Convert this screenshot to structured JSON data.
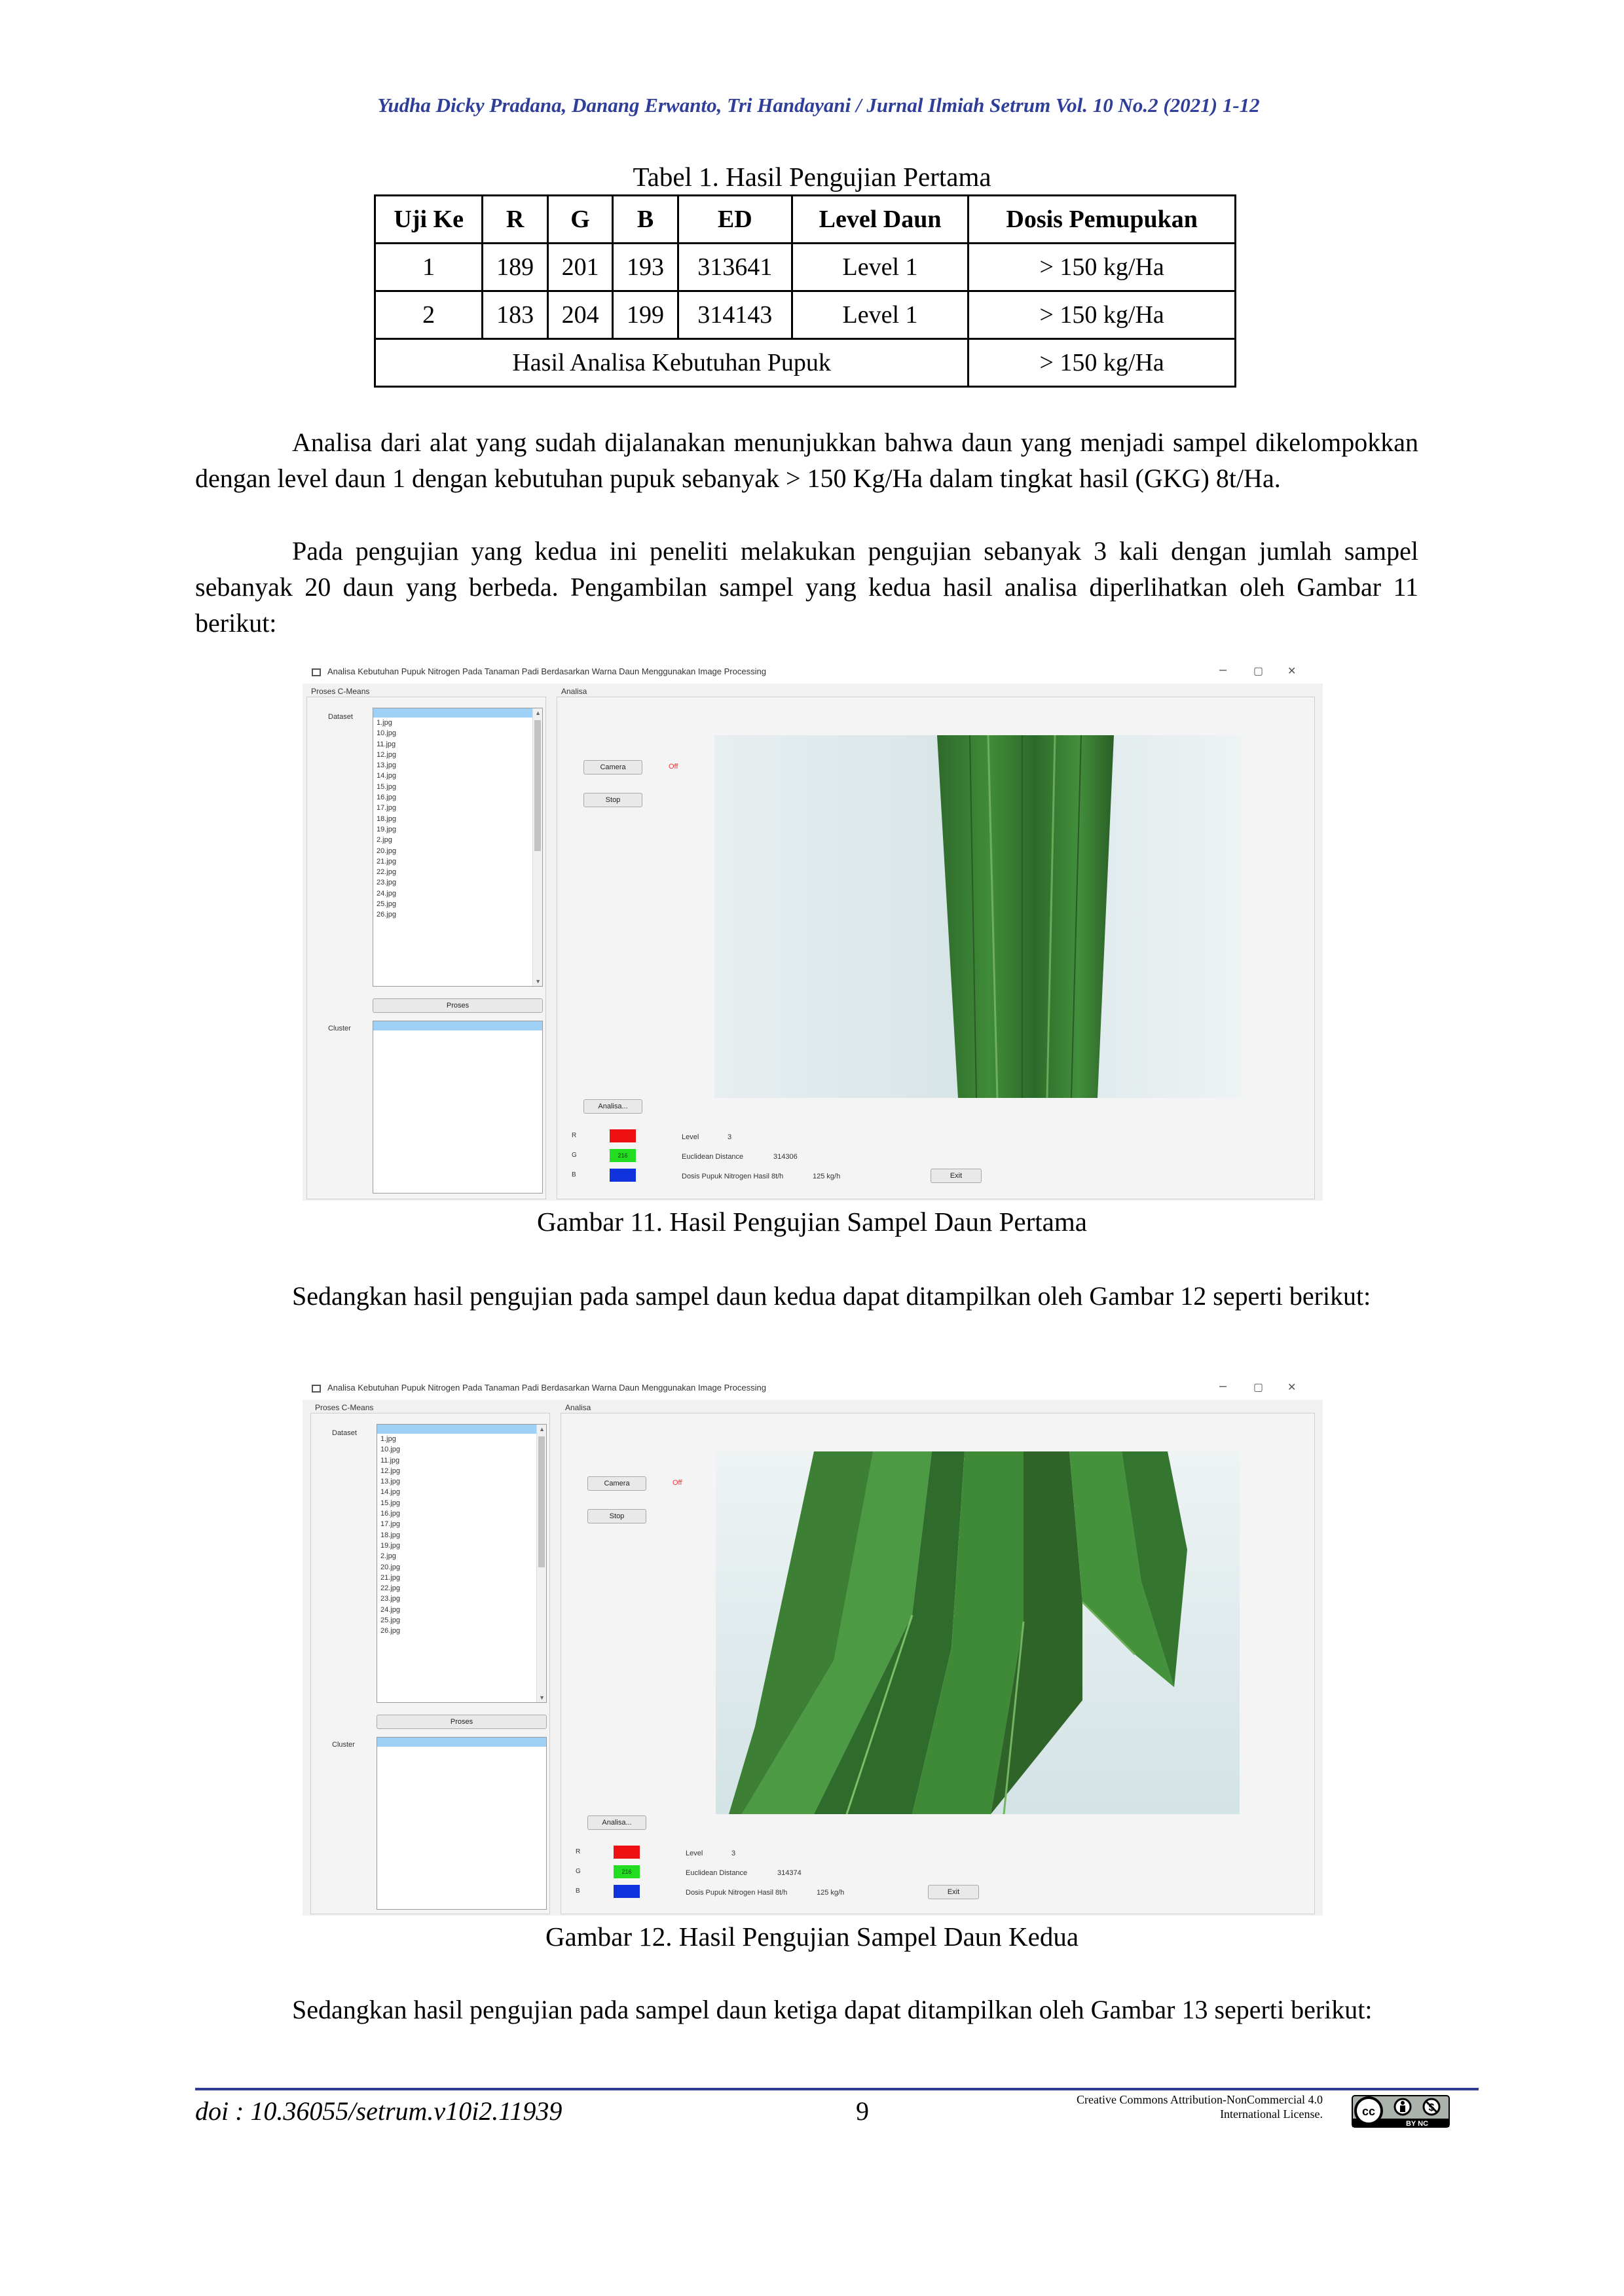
{
  "header": "Yudha Dicky Pradana, Danang Erwanto, Tri Handayani / Jurnal Ilmiah Setrum Vol. 10 No.2 (2021) 1-12",
  "table": {
    "caption": "Tabel 1. Hasil Pengujian Pertama",
    "headers": [
      "Uji Ke",
      "R",
      "G",
      "B",
      "ED",
      "Level Daun",
      "Dosis Pemupukan"
    ],
    "rows": [
      [
        "1",
        "189",
        "201",
        "193",
        "313641",
        "Level 1",
        "> 150 kg/Ha"
      ],
      [
        "2",
        "183",
        "204",
        "199",
        "314143",
        "Level 1",
        "> 150 kg/Ha"
      ]
    ],
    "summary_label": "Hasil Analisa Kebutuhan Pupuk",
    "summary_value": "> 150 kg/Ha"
  },
  "paragraphs": {
    "p1": "Analisa dari alat yang sudah dijalanakan menunjukkan bahwa daun yang menjadi sampel dikelompokkan dengan level daun 1 dengan kebutuhan pupuk sebanyak > 150 Kg/Ha dalam tingkat hasil (GKG) 8t/Ha.",
    "p2": "Pada pengujian yang kedua ini peneliti melakukan pengujian sebanyak 3 kali dengan jumlah sampel sebanyak 20 daun yang berbeda. Pengambilan sampel yang kedua hasil analisa diperlihatkan oleh Gambar 11 berikut:",
    "p3": "Sedangkan hasil pengujian pada sampel daun kedua dapat ditampilkan oleh Gambar 12 seperti berikut:",
    "p4": "Sedangkan hasil pengujian pada sampel daun ketiga dapat ditampilkan oleh Gambar 13 seperti berikut:"
  },
  "app": {
    "title": "Analisa Kebutuhan Pupuk Nitrogen Pada Tanaman Padi Berdasarkan Warna Daun Menggunakan Image Processing",
    "window_controls": [
      "–",
      "▢",
      "✕"
    ],
    "panel_left": "Proses C-Means",
    "panel_right": "Analisa",
    "dataset_label": "Dataset",
    "cluster_label": "Cluster",
    "dataset_items": [
      "1.jpg",
      "10.jpg",
      "11.jpg",
      "12.jpg",
      "13.jpg",
      "14.jpg",
      "15.jpg",
      "16.jpg",
      "17.jpg",
      "18.jpg",
      "19.jpg",
      "2.jpg",
      "20.jpg",
      "21.jpg",
      "22.jpg",
      "23.jpg",
      "24.jpg",
      "25.jpg",
      "26.jpg"
    ],
    "proses_btn": "Proses",
    "camera_btn": "Camera",
    "stop_btn": "Stop",
    "status": "Off",
    "analisa_btn": "Analisa...",
    "exit_btn": "Exit",
    "r_label": "R",
    "g_label": "G",
    "b_label": "B",
    "red_color": "#ee1111",
    "green_color": "#22dd22",
    "blue_color": "#1133dd",
    "euclidean_label": "Euclidean Distance",
    "dosis_label": "Dosis Pupuk Nitrogen Hasil 8t/h"
  },
  "figures": [
    {
      "caption": "Gambar 11. Hasil Pengujian Sampel Daun Pertama",
      "g_value": "216",
      "level_label": "Level",
      "level_value": "3",
      "euclidean_value": "314306",
      "dosis_value": "125 kg/h"
    },
    {
      "caption": "Gambar 12. Hasil Pengujian Sampel Daun Kedua",
      "g_value": "216",
      "level_label": "Level",
      "level_value": "3",
      "euclidean_value": "314374",
      "dosis_value": "125 kg/h"
    }
  ],
  "footer": {
    "doi": "doi : 10.36055/setrum.v10i2.11939",
    "page": "9",
    "license_line1": "Creative Commons Attribution-NonCommercial 4.0",
    "license_line2": "International License.",
    "badge_text": "BY NC"
  }
}
